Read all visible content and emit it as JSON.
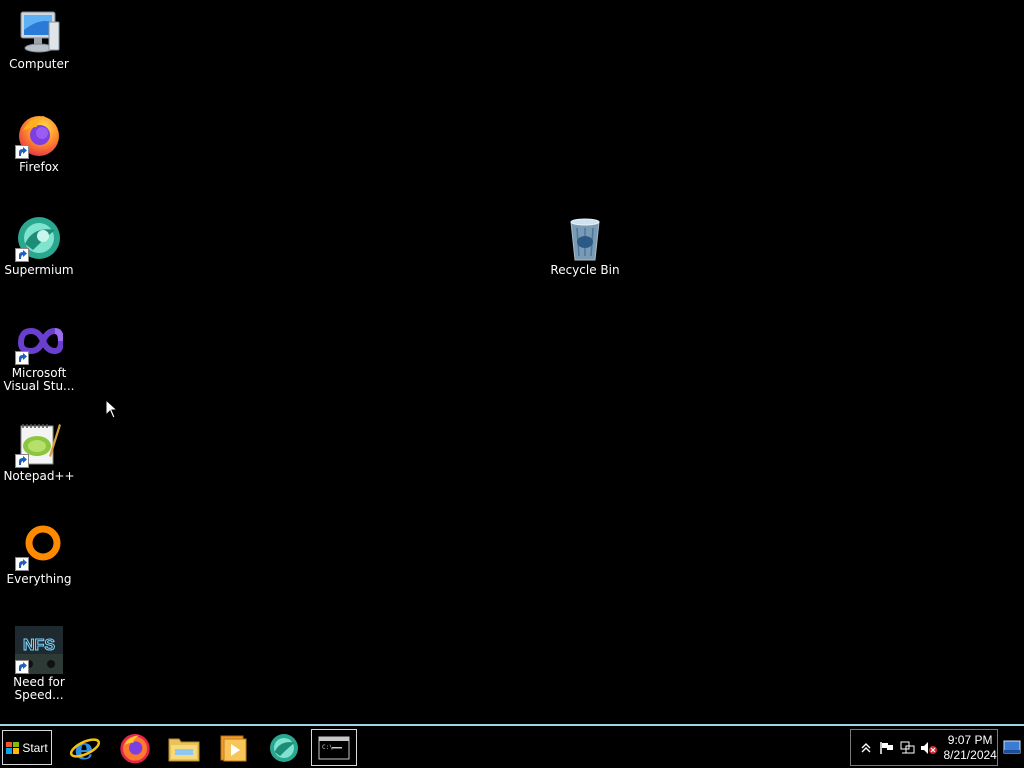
{
  "desktop": {
    "icons": [
      {
        "label": "Computer",
        "icon": "computer-icon"
      },
      {
        "label": "Firefox",
        "icon": "firefox-icon"
      },
      {
        "label": "Supermium",
        "icon": "supermium-icon"
      },
      {
        "label": "Microsoft Visual Stu...",
        "icon": "visual-studio-icon"
      },
      {
        "label": "Notepad++",
        "icon": "notepad-plus-plus-icon"
      },
      {
        "label": "Everything",
        "icon": "everything-icon"
      },
      {
        "label": "Need for Speed...",
        "icon": "need-for-speed-icon"
      },
      {
        "label": "Recycle Bin",
        "icon": "recycle-bin-icon"
      }
    ]
  },
  "taskbar": {
    "start_label": "Start",
    "pinned": [
      {
        "name": "Internet Explorer",
        "icon": "internet-explorer-icon"
      },
      {
        "name": "Firefox",
        "icon": "firefox-icon"
      },
      {
        "name": "File Explorer",
        "icon": "file-explorer-icon"
      },
      {
        "name": "Media Player",
        "icon": "media-player-icon"
      },
      {
        "name": "Supermium",
        "icon": "supermium-icon"
      },
      {
        "name": "Command Prompt",
        "icon": "command-prompt-icon",
        "active": true
      }
    ],
    "tray": {
      "icons": [
        "show-hidden-icons-chevron-icon",
        "action-center-flag-icon",
        "network-icon",
        "volume-muted-icon"
      ],
      "time": "9:07 PM",
      "date": "8/21/2024"
    }
  },
  "colors": {
    "desktop_background": "#000000",
    "taskbar_border": "#9fd3e6"
  }
}
